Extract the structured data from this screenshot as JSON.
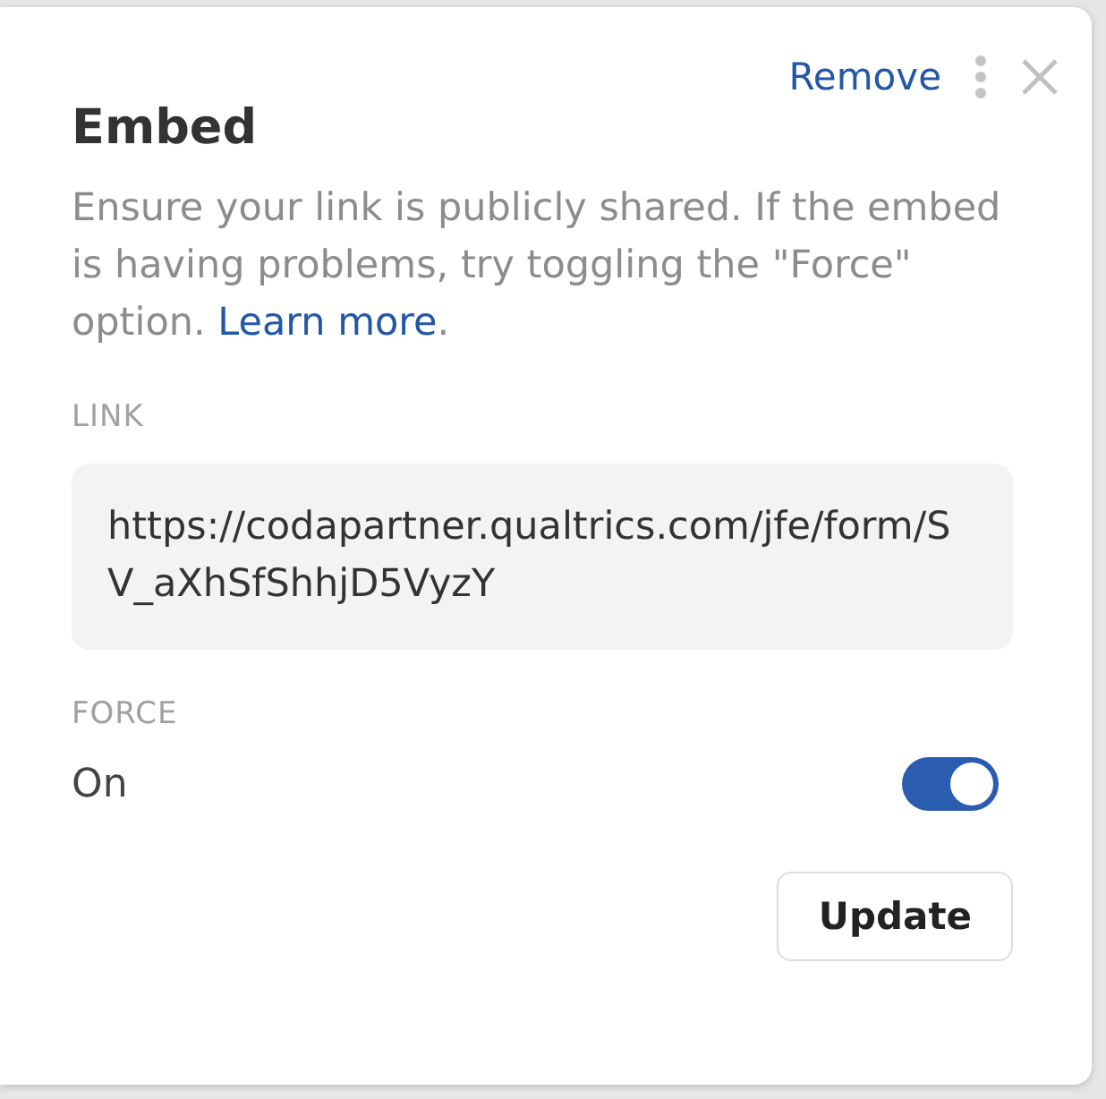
{
  "panel": {
    "title": "Embed",
    "remove_link": "Remove",
    "description": "Ensure your link is publicly shared. If the embed is having problems, try toggling the \"Force\" option.",
    "learn_more": "Learn more",
    "description_end": ".",
    "link": {
      "label": "LINK",
      "value": "https://codapartner.qualtrics.com/jfe/form/SV_aXhSfShhjD5VyzY"
    },
    "force": {
      "label": "FORCE",
      "state_text": "On",
      "on": true
    },
    "buttons": [
      "Update"
    ]
  }
}
